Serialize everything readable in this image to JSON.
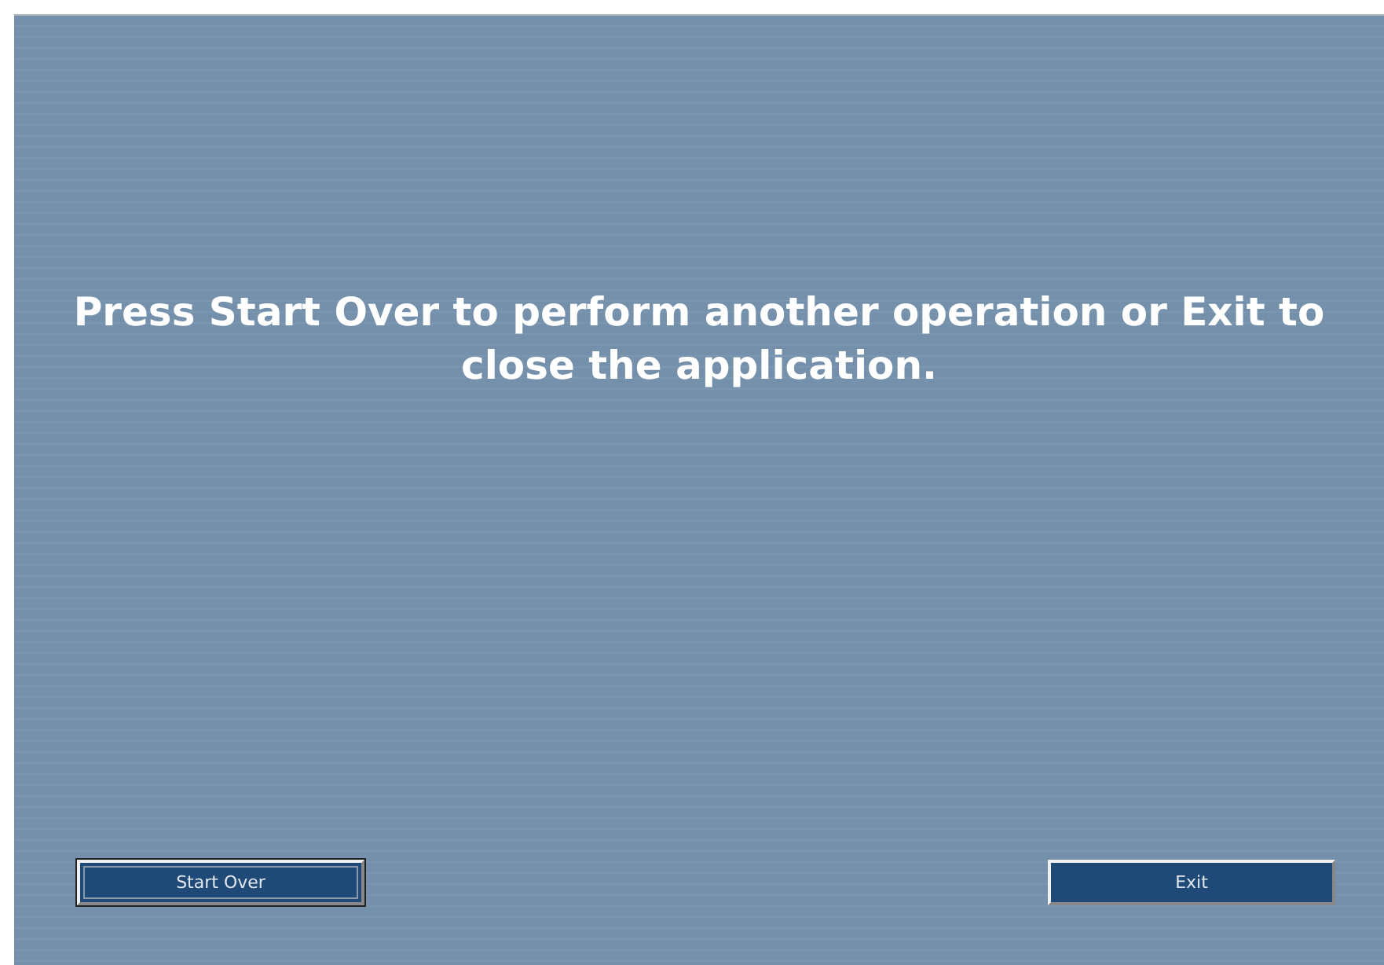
{
  "message": "Press Start Over to perform another operation or Exit to close the application.",
  "buttons": [
    {
      "label": "Start Over",
      "focused": true
    },
    {
      "label": "Exit",
      "focused": false
    }
  ]
}
